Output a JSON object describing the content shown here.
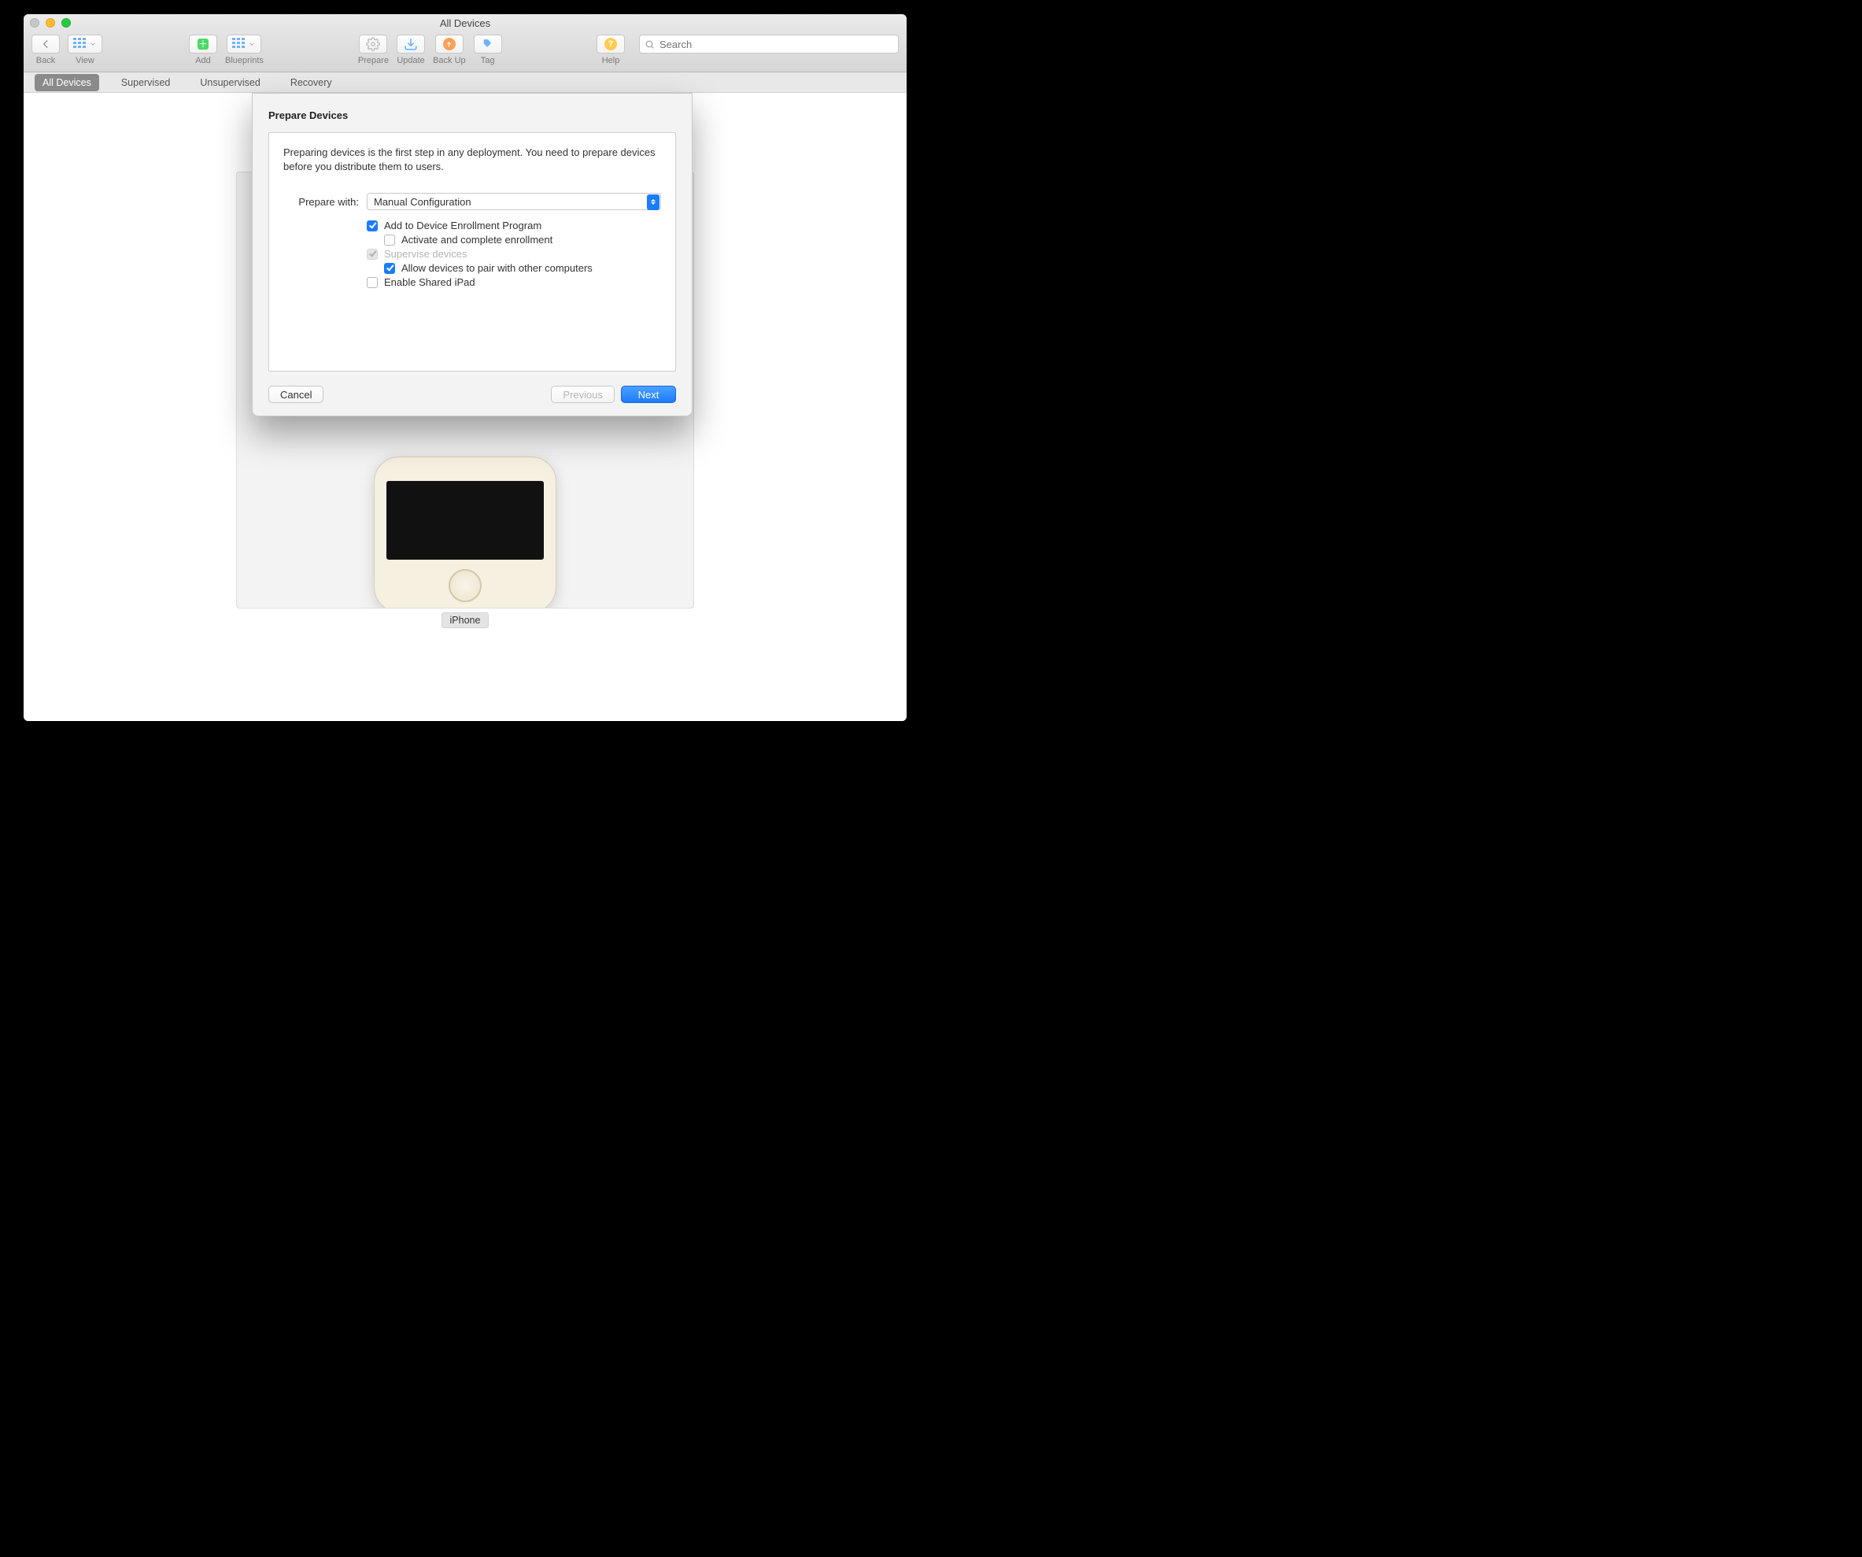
{
  "window_title": "All Devices",
  "toolbar": {
    "back": "Back",
    "view": "View",
    "add": "Add",
    "blueprints": "Blueprints",
    "prepare": "Prepare",
    "update": "Update",
    "back_up": "Back Up",
    "tag": "Tag",
    "help": "Help"
  },
  "search_placeholder": "Search",
  "tabs": {
    "all": "All Devices",
    "supervised": "Supervised",
    "unsupervised": "Unsupervised",
    "recovery": "Recovery"
  },
  "device_label": "iPhone",
  "sheet": {
    "title": "Prepare Devices",
    "desc": "Preparing devices is the first step in any deployment. You need to prepare devices before you distribute them to users.",
    "prepare_with_label": "Prepare with:",
    "prepare_with_value": "Manual Configuration",
    "chk_add_dep": "Add to Device Enrollment Program",
    "chk_activate": "Activate and complete enrollment",
    "chk_supervise": "Supervise devices",
    "chk_allow_pair": "Allow devices to pair with other computers",
    "chk_shared_ipad": "Enable Shared iPad",
    "cancel": "Cancel",
    "previous": "Previous",
    "next": "Next"
  }
}
